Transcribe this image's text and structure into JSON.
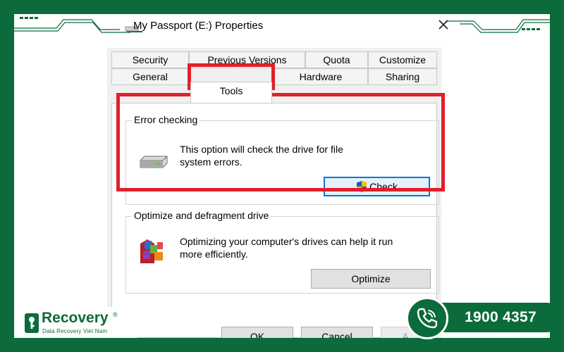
{
  "window": {
    "title": "My Passport (E:) Properties",
    "close_icon": "close-icon"
  },
  "tabs": {
    "row1": [
      "Security",
      "Previous Versions",
      "Quota",
      "Customize"
    ],
    "row2": [
      "General",
      "Tools",
      "Hardware",
      "Sharing"
    ],
    "active": "Tools"
  },
  "error_checking": {
    "label": "Error checking",
    "desc_line1": "This option will check the drive for file",
    "desc_line2": "system errors.",
    "button": "Check",
    "icon": "drive-icon",
    "button_icon": "uac-shield-icon"
  },
  "optimize": {
    "label": "Optimize and defragment drive",
    "desc_line1": "Optimizing your computer's drives can help it run",
    "desc_line2": "more efficiently.",
    "button": "Optimize",
    "icon": "defrag-icon"
  },
  "footer": {
    "ok": "OK",
    "cancel": "Cancel",
    "apply": "A"
  },
  "branding": {
    "name": "Recovery",
    "registered": "®",
    "subtitle": "Data Recovery Viet Nam",
    "hotline": "1900 4357"
  },
  "colors": {
    "brand_green": "#0b6b3a",
    "highlight_red": "#e0202a",
    "focus_blue": "#0078d7"
  }
}
